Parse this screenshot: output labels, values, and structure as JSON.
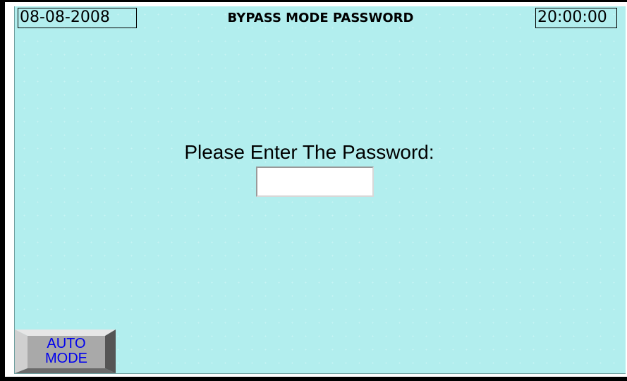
{
  "header": {
    "date": "08-08-2008",
    "title": "BYPASS MODE PASSWORD",
    "time": "20:00:00"
  },
  "password_prompt": {
    "label": "Please Enter The Password:",
    "value": ""
  },
  "auto_mode_button": {
    "label": "AUTO\nMODE"
  },
  "colors": {
    "screen_background": "#b2eeee",
    "button_face": "#a9a9a9",
    "button_text": "#0000ee",
    "text": "#000000"
  }
}
